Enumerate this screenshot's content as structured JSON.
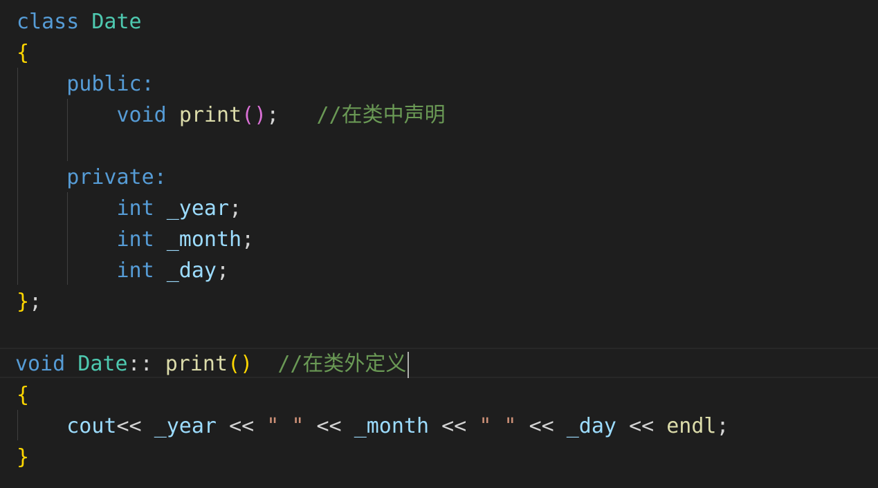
{
  "editor": {
    "theme_colors": {
      "background": "#1e1e1e",
      "keyword": "#569cd6",
      "type": "#4ec9b0",
      "function": "#dcdcaa",
      "variable": "#9cdcfe",
      "bracket_level1": "#ffd700",
      "bracket_level2": "#da70d6",
      "comment": "#6a9955",
      "string": "#ce9178"
    },
    "code": {
      "l1_kw": "class",
      "l1_type": "Date",
      "l2_brace": "{",
      "l3_kw": "public",
      "l3_colon": ":",
      "l4_kw": "void",
      "l4_fn": "print",
      "l4_paren": "()",
      "l4_semi": ";",
      "l4_comment": "//在类中声明",
      "l6_kw": "private",
      "l6_colon": ":",
      "l7_kw": "int",
      "l7_var": "_year",
      "l7_semi": ";",
      "l8_kw": "int",
      "l8_var": "_month",
      "l8_semi": ";",
      "l9_kw": "int",
      "l9_var": "_day",
      "l9_semi": ";",
      "l10_brace": "}",
      "l10_semi": ";",
      "l12_kw": "void",
      "l12_type": "Date",
      "l12_scope": "::",
      "l12_fn": "print",
      "l12_paren": "()",
      "l12_comment": "//在类外定义",
      "l13_brace": "{",
      "l14_cout": "cout",
      "l14_op": "<<",
      "l14_year": "_year",
      "l14_str": "\" \"",
      "l14_month": "_month",
      "l14_day": "_day",
      "l14_endl": "endl",
      "l14_semi": ";",
      "l15_brace": "}"
    }
  }
}
